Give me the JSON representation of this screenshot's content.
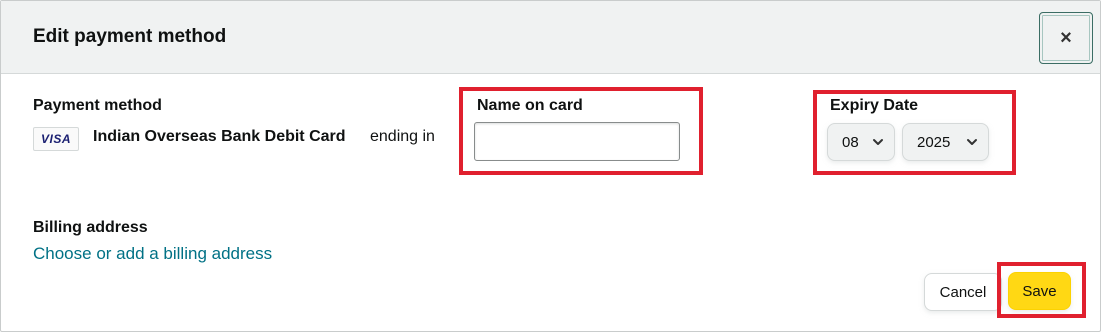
{
  "dialog": {
    "title": "Edit payment method",
    "close_label": "×"
  },
  "payment_method": {
    "label": "Payment method",
    "card_brand": "VISA",
    "card_name": "Indian Overseas Bank Debit Card",
    "ending_text": "ending in"
  },
  "name_on_card": {
    "label": "Name on card",
    "value": "",
    "placeholder": ""
  },
  "expiry": {
    "label": "Expiry Date",
    "month": "08",
    "year": "2025"
  },
  "billing": {
    "label": "Billing address",
    "link_text": "Choose or add a billing address"
  },
  "actions": {
    "cancel_label": "Cancel",
    "save_label": "Save"
  },
  "colors": {
    "link": "#007185",
    "save_button": "#ffd814",
    "highlight": "#e0202e",
    "header_bg": "#f0f2f2"
  },
  "icons": {
    "close": "close-icon",
    "dropdown": "chevron-down-icon",
    "card_logo": "visa-logo-icon"
  }
}
